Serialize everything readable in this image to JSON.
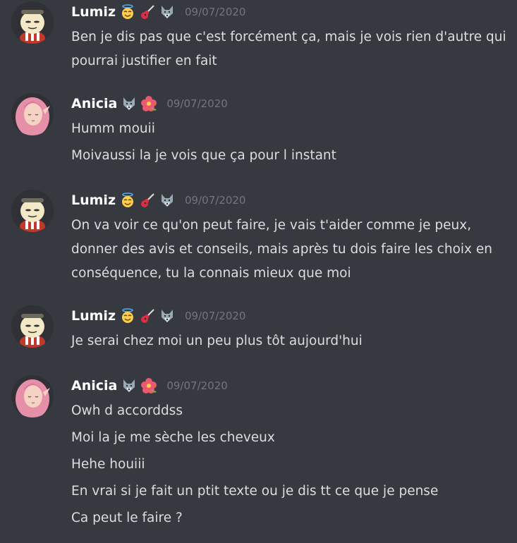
{
  "messages": [
    {
      "author": "Lumiz",
      "time": "09/07/2020",
      "lines": [
        "Ben je dis pas que c'est forcément ça, mais je vois rien d'autre qui pourrai justifier en fait"
      ]
    },
    {
      "author": "Anicia",
      "time": "09/07/2020",
      "lines": [
        "Humm mouii",
        "Moivaussi la je vois que ça pour l instant"
      ]
    },
    {
      "author": "Lumiz",
      "time": "09/07/2020",
      "lines": [
        "On va voir ce qu'on peut faire, je vais t'aider comme je peux, donner des avis et conseils, mais après tu dois faire les choix en conséquence, tu la connais mieux que moi"
      ]
    },
    {
      "author": "Lumiz",
      "time": "09/07/2020",
      "lines": [
        "Je serai chez moi un peu plus tôt aujourd'hui"
      ]
    },
    {
      "author": "Anicia",
      "time": "09/07/2020",
      "lines": [
        "Owh d accorddss",
        "Moi la je me sèche les cheveux",
        "Hehe houiii",
        "En vrai si je fait un ptit texte ou je dis tt ce que je pense",
        "Ca peut le faire ?"
      ]
    }
  ],
  "badges": {
    "lumiz": [
      "smiling-face-with-halo-icon",
      "guitar-icon",
      "wolf-icon"
    ],
    "anicia": [
      "wolf-icon",
      "hibiscus-icon"
    ]
  },
  "colors": {
    "background": "#36393f",
    "username": "#ffffff",
    "text": "#dcddde",
    "timestamp": "#72767d"
  }
}
